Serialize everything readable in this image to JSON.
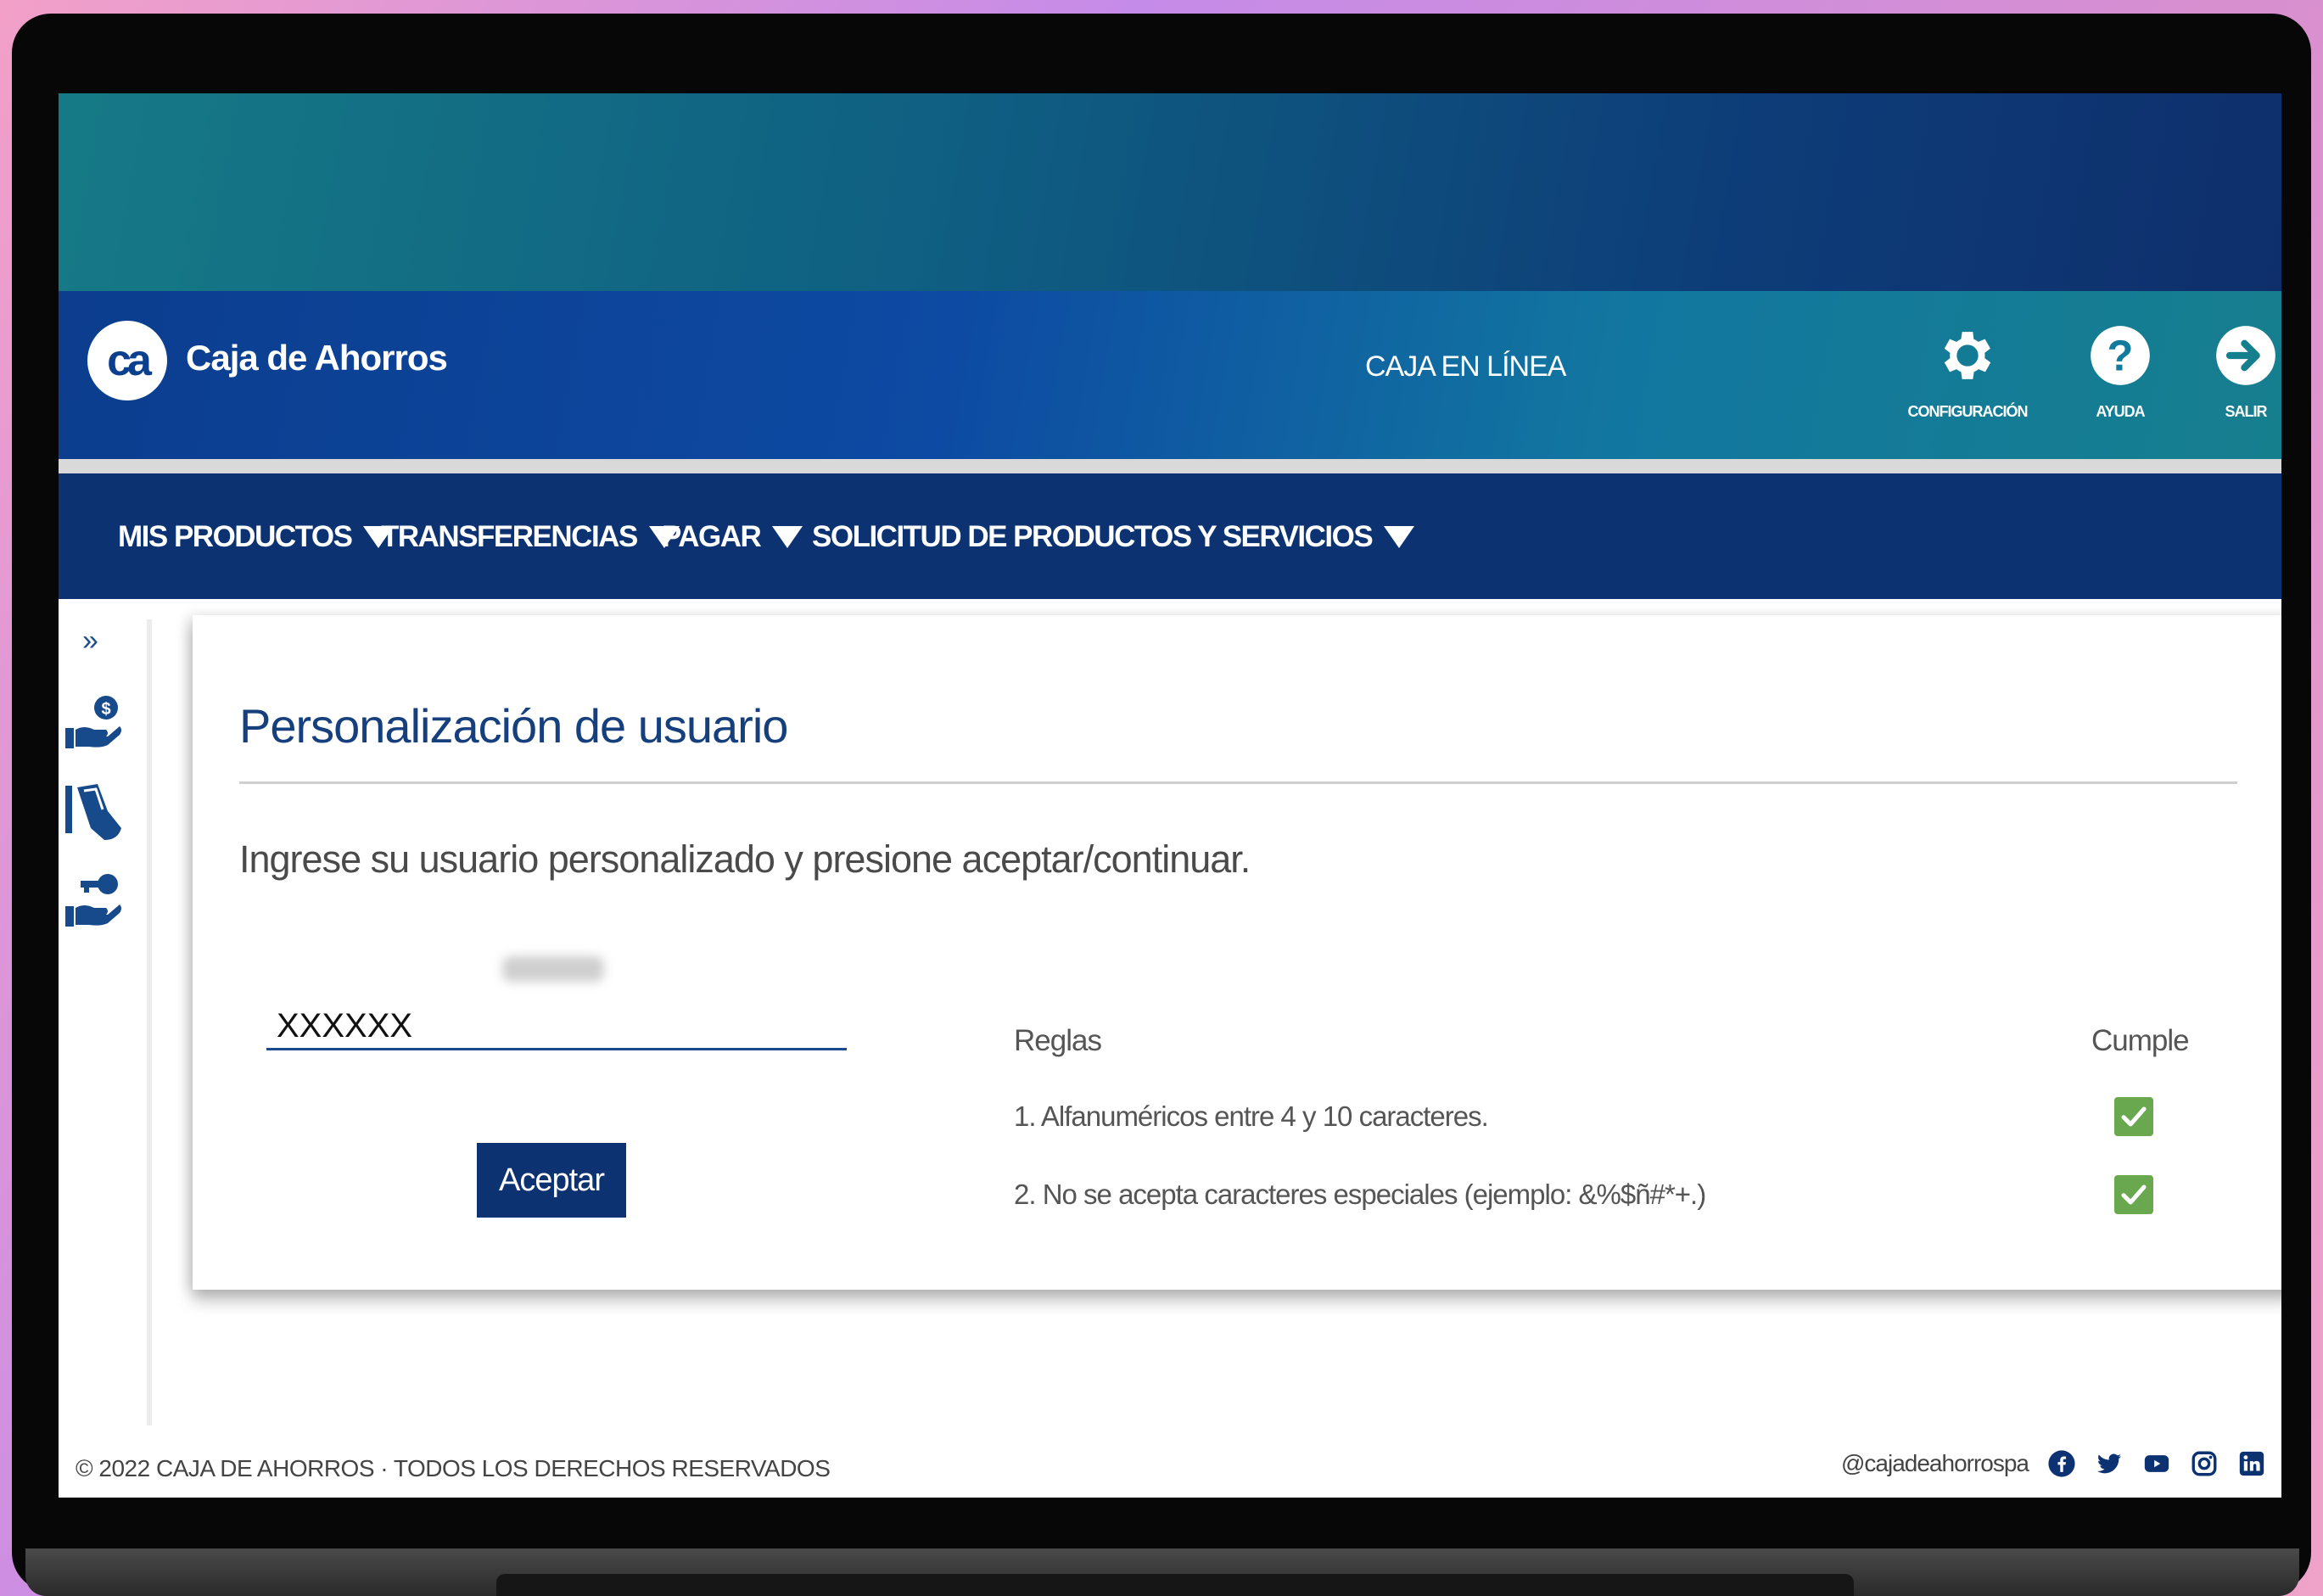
{
  "header": {
    "brand_logo_text": "ca",
    "brand_name": "Caja de Ahorros",
    "center_title": "CAJA EN LÍNEA",
    "tools": [
      {
        "label": "CONFIGURACIÓN",
        "icon": "gear-icon"
      },
      {
        "label": "AYUDA",
        "icon": "help-icon"
      },
      {
        "label": "SALIR",
        "icon": "logout-icon"
      }
    ]
  },
  "nav": {
    "items": [
      {
        "label": "MIS PRODUCTOS"
      },
      {
        "label": "TRANSFERENCIAS"
      },
      {
        "label": "PAGAR"
      },
      {
        "label": "SOLICITUD DE PRODUCTOS Y SERVICIOS"
      }
    ]
  },
  "sidebar": {
    "expand_glyph": "»",
    "icons": [
      "hand-coin-icon",
      "hand-card-icon",
      "hand-key-icon"
    ]
  },
  "main": {
    "title": "Personalización de usuario",
    "instruction": "Ingrese su usuario personalizado y presione aceptar/continuar.",
    "username_value": "XXXXXX",
    "accept_label": "Aceptar",
    "rules_header": "Reglas",
    "complies_header": "Cumple",
    "rules": [
      {
        "text": "1. Alfanuméricos entre 4 y 10 caracteres.",
        "complies": true
      },
      {
        "text": "2. No se acepta caracteres especiales (ejemplo: &%$ñ#*+.)",
        "complies": true
      }
    ]
  },
  "footer": {
    "copyright": "© 2022 CAJA DE AHORROS · TODOS LOS DERECHOS RESERVADOS",
    "handle": "@cajadeahorrospa",
    "social": [
      "facebook-icon",
      "twitter-icon",
      "youtube-icon",
      "instagram-icon",
      "linkedin-icon"
    ]
  },
  "colors": {
    "primary_navy": "#0c3272",
    "title_blue": "#163f7d",
    "check_green": "#6aa84f"
  }
}
